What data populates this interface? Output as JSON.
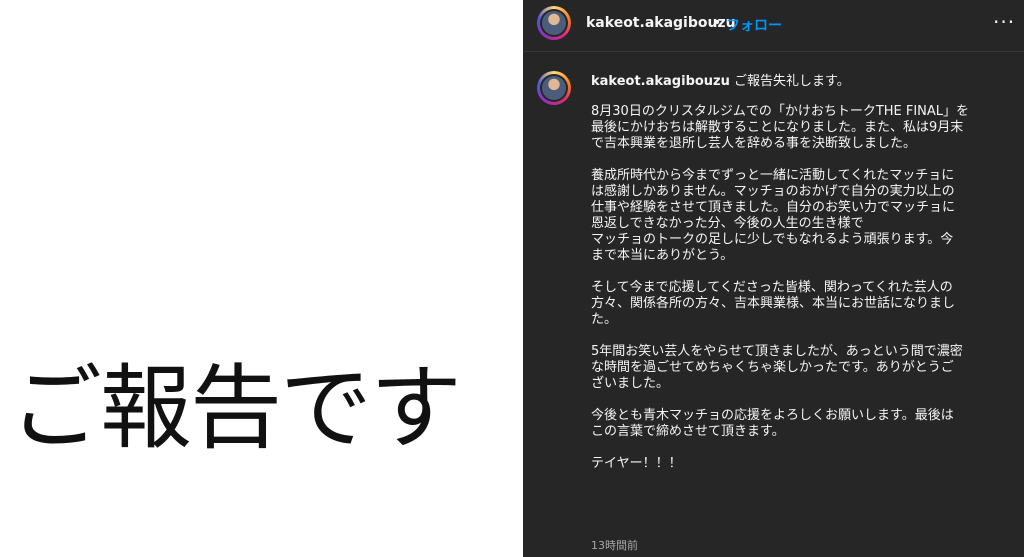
{
  "image_text": "ご報告です",
  "header": {
    "username": "kakeot.akagibouzu",
    "separator": "•",
    "follow_label": "フォロー",
    "more_label": "···"
  },
  "caption": {
    "username": "kakeot.akagibouzu",
    "first_line": "ご報告失礼します。",
    "paragraphs": [
      "8月30日のクリスタルジムでの「かけおちトークTHE FINAL」を\n最後にかけおちは解散することになりました。また、私は9月末\nで吉本興業を退所し芸人を辞める事を決断致しました。",
      "養成所時代から今までずっと一緒に活動してくれたマッチョに\nは感謝しかありません。マッチョのおかげで自分の実力以上の\n仕事や経験をさせて頂きました。自分のお笑い力でマッチョに\n恩返しできなかった分、今後の人生の生き様で\nマッチョのトークの足しに少しでもなれるよう頑張ります。今\nまで本当にありがとう。",
      "そして今まで応援してくださった皆様、関わってくれた芸人の\n方々、関係各所の方々、吉本興業様、本当にお世話になりまし\nた。",
      "5年間お笑い芸人をやらせて頂きましたが、あっという間で濃密\nな時間を過ごせてめちゃくちゃ楽しかったです。ありがとうご\nざいました。",
      "今後とも青木マッチョの応援をよろしくお願いします。最後は\nこの言葉で締めさせて頂きます。",
      "テイヤー！！！"
    ]
  },
  "timestamp": "13時間前"
}
